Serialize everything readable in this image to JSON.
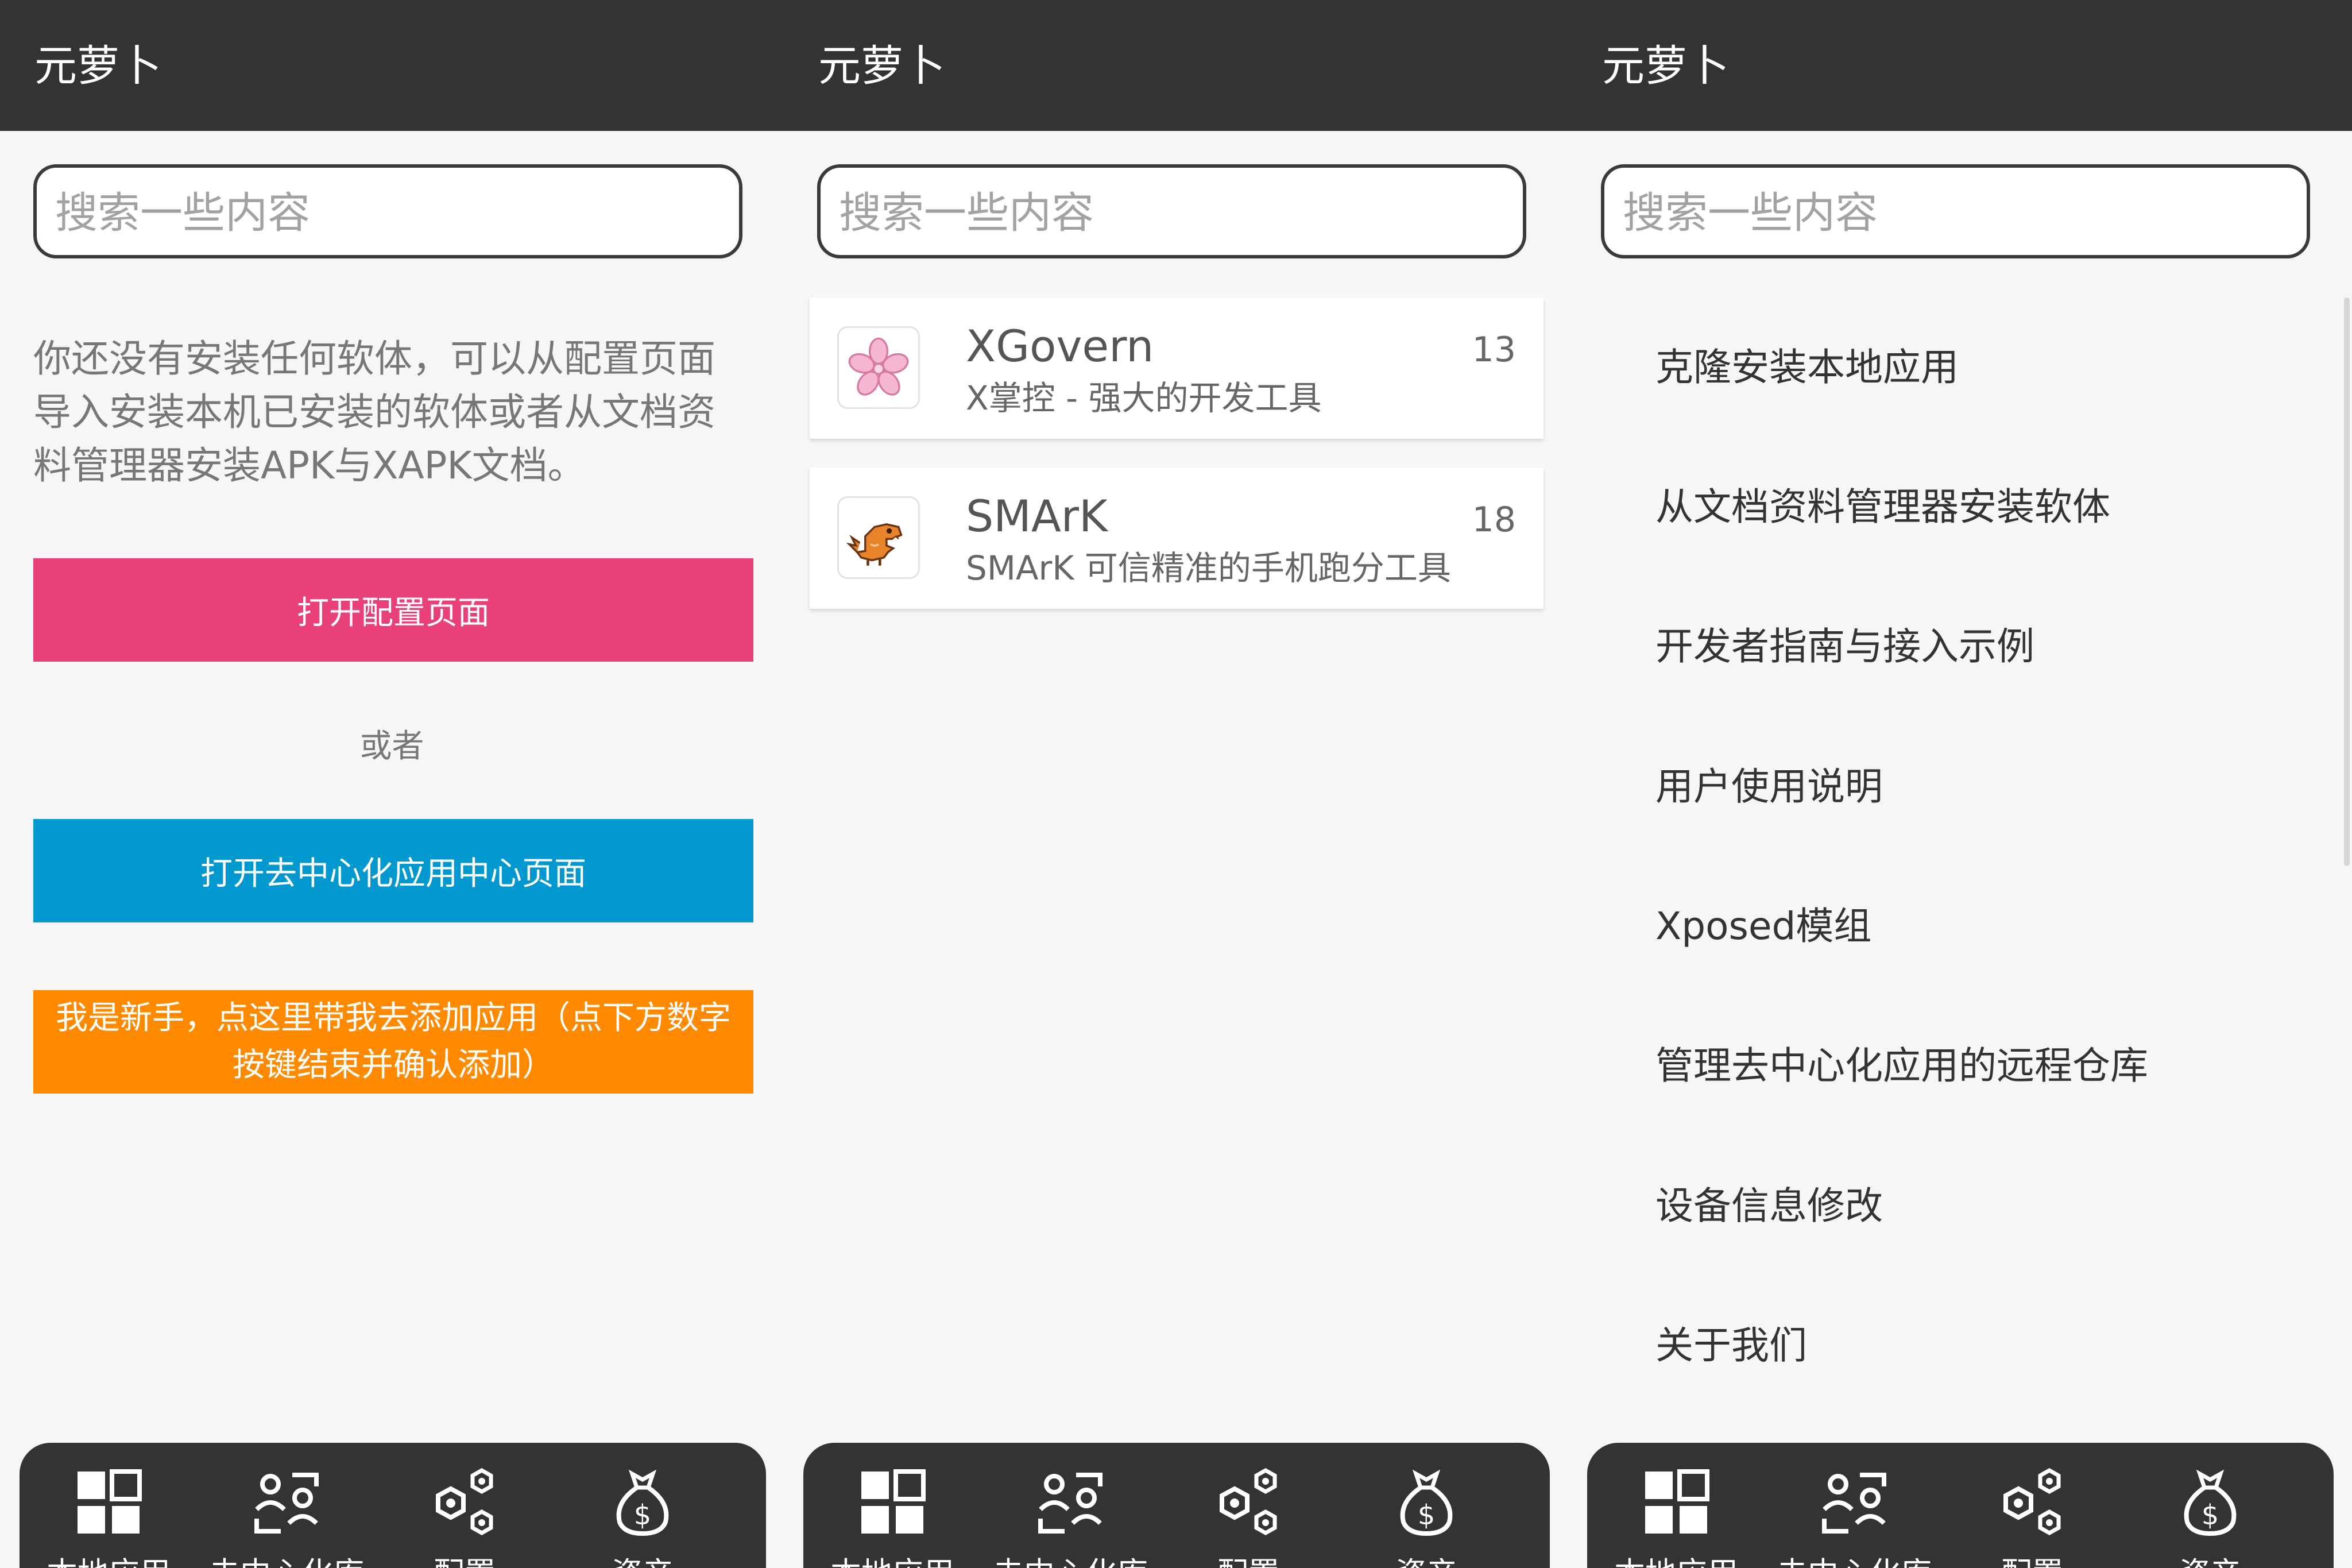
{
  "app": {
    "title": "元萝卜"
  },
  "search": {
    "placeholder": "搜索一些内容"
  },
  "local": {
    "empty_message": "你还没有安装任何软体，可以从配置页面导入安装本机已安装的软体或者从文档资料管理器安装APK与XAPK文档。",
    "open_config_label": "打开配置页面",
    "or_label": "或者",
    "open_center_label": "打开去中心化应用中心页面",
    "newbie_label": "我是新手，点这里带我去添加应用（点下方数字按键结束并确认添加）"
  },
  "repo": {
    "apps": [
      {
        "name": "XGovern",
        "description": "X掌控 - 强大的开发工具",
        "count": "13",
        "icon": "cherry-blossom-icon"
      },
      {
        "name": "SMArK",
        "description": "SMArK 可信精准的手机跑分工具",
        "count": "18",
        "icon": "dinosaur-icon"
      }
    ]
  },
  "config": {
    "items": [
      "克隆安装本地应用",
      "从文档资料管理器安装软体",
      "开发者指南与接入示例",
      "用户使用说明",
      "Xposed模组",
      "管理去中心化应用的远程仓库",
      "设备信息修改",
      "关于我们"
    ]
  },
  "nav": {
    "items": [
      {
        "label": "本地应用",
        "icon": "grid-icon"
      },
      {
        "label": "去中心化库",
        "icon": "people-icon"
      },
      {
        "label": "配置",
        "icon": "gears-icon"
      },
      {
        "label": "资产",
        "icon": "money-bag-icon"
      }
    ]
  },
  "colors": {
    "topbar": "#333333",
    "config_button": "#e9407a",
    "center_button": "#0098cf",
    "newbie_button": "#ff8a00"
  }
}
